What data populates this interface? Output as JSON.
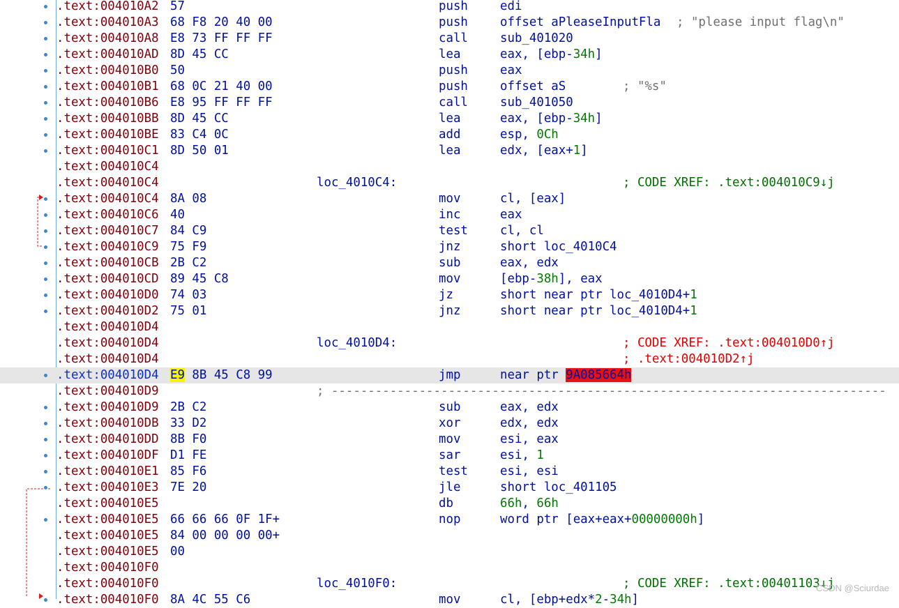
{
  "theme": {
    "address_color": "#80000a",
    "current_address_color": "#1030c0",
    "instruction_color": "#0010a0",
    "number_color": "#007a00",
    "comment_color": "#707070",
    "xref_color": "#007000",
    "red_xref_color": "#e00000",
    "current_line_bg": "#e6e6e6",
    "highlight_yellow": "#f4f400",
    "highlight_red": "#e81010"
  },
  "lines": [
    {
      "addr": ".text:004010A2",
      "bytes": "57",
      "mnem": "push",
      "ops": [
        {
          "t": "edi"
        }
      ],
      "dot": true
    },
    {
      "addr": ".text:004010A3",
      "bytes": "68 F8 20 40 00",
      "mnem": "push",
      "ops": [
        {
          "t": "offset aPleaseInputFla "
        }
      ],
      "comment": "; \"please input flag\\n\"",
      "ccls": "",
      "dot": true
    },
    {
      "addr": ".text:004010A8",
      "bytes": "E8 73 FF FF FF",
      "mnem": "call",
      "ops": [
        {
          "t": "sub_401020"
        }
      ],
      "dot": true
    },
    {
      "addr": ".text:004010AD",
      "bytes": "8D 45 CC",
      "mnem": "lea",
      "ops": [
        {
          "t": "eax, [ebp-"
        },
        {
          "t": "34h",
          "n": 1
        },
        {
          "t": "]"
        }
      ],
      "dot": true
    },
    {
      "addr": ".text:004010B0",
      "bytes": "50",
      "mnem": "push",
      "ops": [
        {
          "t": "eax"
        }
      ],
      "dot": true
    },
    {
      "addr": ".text:004010B1",
      "bytes": "68 0C 21 40 00",
      "mnem": "push",
      "ops": [
        {
          "t": "offset aS"
        }
      ],
      "comment": "; \"%s\"",
      "ccls": "",
      "dot": true
    },
    {
      "addr": ".text:004010B6",
      "bytes": "E8 95 FF FF FF",
      "mnem": "call",
      "ops": [
        {
          "t": "sub_401050"
        }
      ],
      "dot": true
    },
    {
      "addr": ".text:004010BB",
      "bytes": "8D 45 CC",
      "mnem": "lea",
      "ops": [
        {
          "t": "eax, [ebp-"
        },
        {
          "t": "34h",
          "n": 1
        },
        {
          "t": "]"
        }
      ],
      "dot": true
    },
    {
      "addr": ".text:004010BE",
      "bytes": "83 C4 0C",
      "mnem": "add",
      "ops": [
        {
          "t": "esp, "
        },
        {
          "t": "0Ch",
          "n": 1
        }
      ],
      "dot": true
    },
    {
      "addr": ".text:004010C1",
      "bytes": "8D 50 01",
      "mnem": "lea",
      "ops": [
        {
          "t": "edx, [eax+"
        },
        {
          "t": "1",
          "n": 1
        },
        {
          "t": "]"
        }
      ],
      "dot": true
    },
    {
      "addr": ".text:004010C4"
    },
    {
      "addr": ".text:004010C4",
      "label": "loc_4010C4:",
      "comment": "; CODE XREF: .text:004010C9↓j",
      "ccls": "xref"
    },
    {
      "addr": ".text:004010C4",
      "bytes": "8A 08",
      "mnem": "mov",
      "ops": [
        {
          "t": "cl, [eax]"
        }
      ],
      "dot": true
    },
    {
      "addr": ".text:004010C6",
      "bytes": "40",
      "mnem": "inc",
      "ops": [
        {
          "t": "eax"
        }
      ],
      "dot": true
    },
    {
      "addr": ".text:004010C7",
      "bytes": "84 C9",
      "mnem": "test",
      "ops": [
        {
          "t": "cl, cl"
        }
      ],
      "dot": true
    },
    {
      "addr": ".text:004010C9",
      "bytes": "75 F9",
      "mnem": "jnz",
      "ops": [
        {
          "t": "short loc_4010C4"
        }
      ],
      "dot": true
    },
    {
      "addr": ".text:004010CB",
      "bytes": "2B C2",
      "mnem": "sub",
      "ops": [
        {
          "t": "eax, edx"
        }
      ],
      "dot": true
    },
    {
      "addr": ".text:004010CD",
      "bytes": "89 45 C8",
      "mnem": "mov",
      "ops": [
        {
          "t": "[ebp-"
        },
        {
          "t": "38h",
          "n": 1
        },
        {
          "t": "], eax"
        }
      ],
      "dot": true
    },
    {
      "addr": ".text:004010D0",
      "bytes": "74 03",
      "mnem": "jz",
      "ops": [
        {
          "t": "short near ptr loc_4010D4+"
        },
        {
          "t": "1",
          "n": 1
        }
      ],
      "dot": true
    },
    {
      "addr": ".text:004010D2",
      "bytes": "75 01",
      "mnem": "jnz",
      "ops": [
        {
          "t": "short near ptr loc_4010D4+"
        },
        {
          "t": "1",
          "n": 1
        }
      ],
      "dot": true
    },
    {
      "addr": ".text:004010D4"
    },
    {
      "addr": ".text:004010D4",
      "label": "loc_4010D4:",
      "comment": "; CODE XREF: .text:004010D0↑j",
      "ccls": "xref-red"
    },
    {
      "addr": ".text:004010D4",
      "comment": "; .text:004010D2↑j",
      "ccls": "xref-red"
    },
    {
      "addr": ".text:004010D4",
      "bytes_hl": "E9",
      "bytes": " 8B 45 C8 99",
      "mnem": "jmp",
      "ops": [
        {
          "t": "near ptr "
        },
        {
          "t": "9A085664h",
          "h": 1
        }
      ],
      "dot": true,
      "current": true
    },
    {
      "addr": ".text:004010D9",
      "sep": "; ----------------------------------------------------------------------------"
    },
    {
      "addr": ".text:004010D9",
      "bytes": "2B C2",
      "mnem": "sub",
      "ops": [
        {
          "t": "eax, edx"
        }
      ],
      "dot": true
    },
    {
      "addr": ".text:004010DB",
      "bytes": "33 D2",
      "mnem": "xor",
      "ops": [
        {
          "t": "edx, edx"
        }
      ],
      "dot": true
    },
    {
      "addr": ".text:004010DD",
      "bytes": "8B F0",
      "mnem": "mov",
      "ops": [
        {
          "t": "esi, eax"
        }
      ],
      "dot": true
    },
    {
      "addr": ".text:004010DF",
      "bytes": "D1 FE",
      "mnem": "sar",
      "ops": [
        {
          "t": "esi, "
        },
        {
          "t": "1",
          "n": 1
        }
      ],
      "dot": true
    },
    {
      "addr": ".text:004010E1",
      "bytes": "85 F6",
      "mnem": "test",
      "ops": [
        {
          "t": "esi, esi"
        }
      ],
      "dot": true
    },
    {
      "addr": ".text:004010E3",
      "bytes": "7E 20",
      "mnem": "jle",
      "ops": [
        {
          "t": "short loc_401105"
        }
      ],
      "dot": true
    },
    {
      "addr": ".text:004010E5",
      "mnem": "db",
      "ops": [
        {
          "t": "66h",
          "n": 1
        },
        {
          "t": ", "
        },
        {
          "t": "66h",
          "n": 1
        }
      ]
    },
    {
      "addr": ".text:004010E5",
      "bytes": "66 66 66 0F 1F+",
      "mnem": "nop",
      "ops": [
        {
          "t": "word ptr [eax+eax+"
        },
        {
          "t": "00000000h",
          "n": 1
        },
        {
          "t": "]"
        }
      ],
      "dot": true
    },
    {
      "addr": ".text:004010E5",
      "bytes": "84 00 00 00 00+"
    },
    {
      "addr": ".text:004010E5",
      "bytes": "00"
    },
    {
      "addr": ".text:004010F0"
    },
    {
      "addr": ".text:004010F0",
      "label": "loc_4010F0:",
      "comment": "; CODE XREF: .text:00401103↓j",
      "ccls": "xref"
    },
    {
      "addr": ".text:004010F0",
      "bytes": "8A 4C 55 C6",
      "mnem": "mov",
      "ops": [
        {
          "t": "cl, [ebp+edx*"
        },
        {
          "t": "2",
          "n": 1
        },
        {
          "t": "-"
        },
        {
          "t": "34h",
          "n": 1
        },
        {
          "t": "]"
        }
      ],
      "dot": true,
      "arrow": true
    }
  ],
  "watermark": "CSDN @Sciurdae"
}
